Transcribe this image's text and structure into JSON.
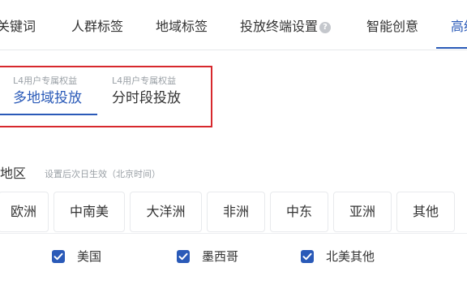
{
  "tabs": [
    {
      "label": "关键词"
    },
    {
      "label": "人群标签"
    },
    {
      "label": "地域标签"
    },
    {
      "label": "投放终端设置"
    },
    {
      "label": "智能创意"
    },
    {
      "label": "高级"
    }
  ],
  "active_tab_index": 5,
  "help_icon": "question-icon",
  "subtabs": [
    {
      "tag": "L4用户专属权益",
      "label": "多地域投放"
    },
    {
      "tag": "L4用户专属权益",
      "label": "分时段投放"
    }
  ],
  "active_subtab_index": 0,
  "region": {
    "title": "选地区",
    "hint": "设置后次日生效（北京时间）"
  },
  "continents": [
    {
      "label": "欧洲"
    },
    {
      "label": "中南美"
    },
    {
      "label": "大洋洲"
    },
    {
      "label": "非洲"
    },
    {
      "label": "中东"
    },
    {
      "label": "亚洲"
    },
    {
      "label": "其他"
    }
  ],
  "countries": [
    {
      "label": "美国",
      "checked": true
    },
    {
      "label": "墨西哥",
      "checked": true
    },
    {
      "label": "北美其他",
      "checked": true
    }
  ],
  "colors": {
    "accent": "#2a5ab8",
    "highlight_border": "#d7282d",
    "muted_text": "#9aa0a6"
  }
}
